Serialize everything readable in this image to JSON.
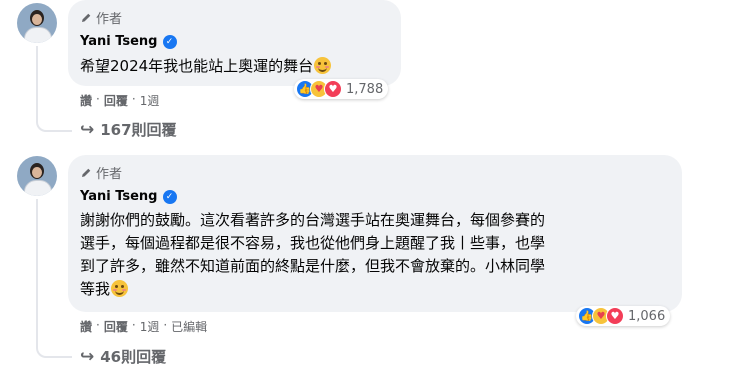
{
  "comments": [
    {
      "author_tag": "作者",
      "author_name": "Yani Tseng",
      "text": "希望2024年我也能站上奧運的舞台",
      "reaction_count": "1,788",
      "actions": {
        "like": "讚",
        "sep1": "·",
        "reply": "回覆",
        "sep2": "·",
        "time": "1週",
        "sep3": "",
        "edited": ""
      },
      "replies_label": "167則回覆"
    },
    {
      "author_tag": "作者",
      "author_name": "Yani Tseng",
      "text_lines": [
        "謝謝你們的鼓勵。這次看著許多的台灣選手站在奧運舞台，每個參賽的",
        "選手，每個過程都是很不容易，我也從他們身上題醒了我丨些事，也學",
        "到了許多，雖然不知道前面的終點是什麼，但我不會放棄的。小林同學",
        "等我"
      ],
      "reaction_count": "1,066",
      "actions": {
        "like": "讚",
        "sep1": "·",
        "reply": "回覆",
        "sep2": "·",
        "time": "1週",
        "sep3": "·",
        "edited": "已編輯"
      },
      "replies_label": "46則回覆"
    }
  ],
  "icons": {
    "author": "pen-icon",
    "verified": "verified-badge-icon",
    "reply_arrow": "reply-arrow-icon",
    "emoji": "smiling-face-icon"
  },
  "colors": {
    "bubble": "#f0f2f5",
    "secondary_text": "#65676b",
    "verified": "#1877f2"
  }
}
